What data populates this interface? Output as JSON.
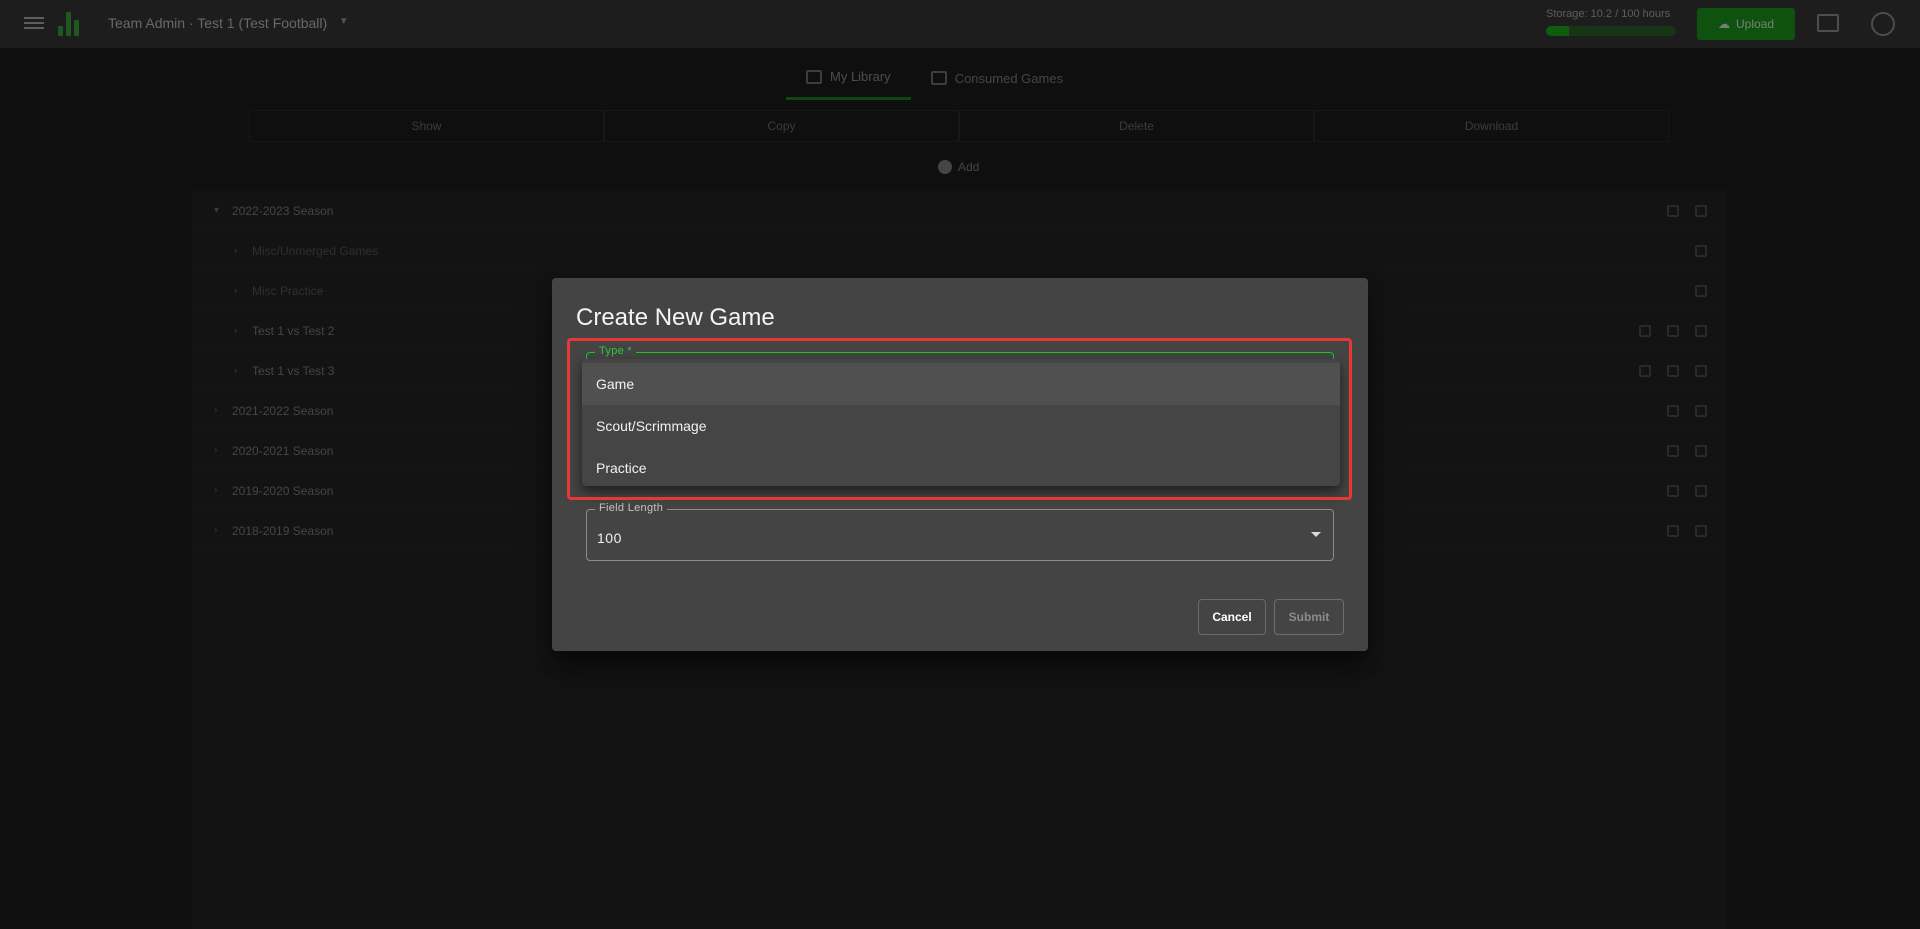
{
  "appbar": {
    "title": "Team Admin · Test 1 (Test Football)",
    "storage_label": "Storage: 10.2 / 100 hours",
    "storage_fraction": 0.18,
    "upload_label": "Upload"
  },
  "library_tabs": [
    {
      "label": "My Library",
      "active": true
    },
    {
      "label": "Consumed Games",
      "active": false
    }
  ],
  "columns": [
    "Show",
    "Copy",
    "Delete",
    "Download"
  ],
  "add_label": "Add",
  "seasons": [
    {
      "label": "2022-2023 Season",
      "level": 0,
      "expanded": true
    },
    {
      "label": "Misc/Unmerged Games",
      "level": 1,
      "dim": true
    },
    {
      "label": "Misc Practice",
      "level": 1,
      "dim": true
    },
    {
      "label": "Test 1 vs Test 2",
      "level": 1
    },
    {
      "label": "Test 1 vs Test 3",
      "level": 1
    },
    {
      "label": "2021-2022 Season",
      "level": 0
    },
    {
      "label": "2020-2021 Season",
      "level": 0
    },
    {
      "label": "2019-2020 Season",
      "level": 0
    },
    {
      "label": "2018-2019 Season",
      "level": 0
    }
  ],
  "dialog": {
    "title": "Create New Game",
    "type_field": {
      "label": "Type *",
      "options": [
        "Game",
        "Scout/Scrimmage",
        "Practice"
      ],
      "hovered_index": 0
    },
    "field_length": {
      "label": "Field Length",
      "value": "100"
    },
    "cancel_label": "Cancel",
    "submit_label": "Submit"
  },
  "colors": {
    "accent_green": "#24c224",
    "highlight_red": "#e53935",
    "dialog_bg": "#444444"
  }
}
